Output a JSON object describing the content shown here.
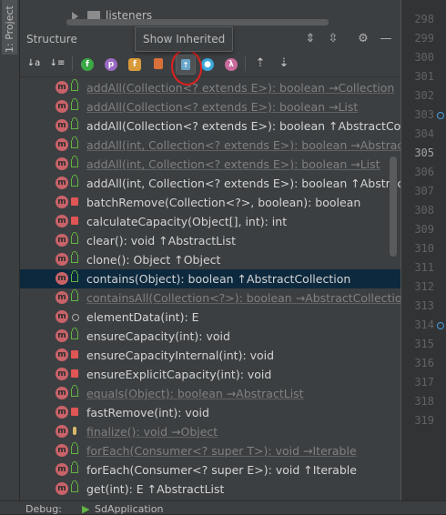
{
  "sidebar": {
    "tab_label": "1: Project"
  },
  "tree_top": {
    "node_label": "listeners"
  },
  "structure": {
    "title": "Structure",
    "tooltip": "Show Inherited",
    "title_icons": {
      "expand": "expand-all-icon",
      "collapse": "collapse-all-icon",
      "settings": "gear-icon",
      "hide": "minimize-icon"
    },
    "toolbar": [
      {
        "name": "sort-alpha-icon",
        "glyph": "↓a"
      },
      {
        "name": "sort-visibility-icon",
        "glyph": "↓≡"
      },
      {
        "name": "show-fields-icon",
        "glyph": "f",
        "color": "#3aa845"
      },
      {
        "name": "show-properties-icon",
        "glyph": "p",
        "color": "#9b6bc4"
      },
      {
        "name": "show-fields-f-icon",
        "glyph": "f",
        "color": "#d99a3a"
      },
      {
        "name": "show-non-public-icon",
        "glyph": "🔒"
      },
      {
        "name": "show-inherited-icon",
        "glyph": "↑",
        "selected": true
      },
      {
        "name": "show-anonymous-icon",
        "glyph": "●",
        "color": "#3ca6d9"
      },
      {
        "name": "show-lambdas-icon",
        "glyph": "λ",
        "color": "#c86a9b"
      },
      {
        "name": "autoscroll-to-source-icon",
        "glyph": "⇡"
      },
      {
        "name": "autoscroll-from-source-icon",
        "glyph": "⇣"
      }
    ]
  },
  "members": [
    {
      "access": "public",
      "text": "addAll(Collection<? extends E>): boolean →Collection",
      "inherited": true
    },
    {
      "access": "public",
      "text": "addAll(Collection<? extends E>): boolean →List",
      "inherited": true
    },
    {
      "access": "public",
      "text": "addAll(Collection<? extends E>): boolean ↑AbstractCollection",
      "inherited": false
    },
    {
      "access": "public",
      "text": "addAll(int, Collection<? extends E>): boolean →AbstractList",
      "inherited": true
    },
    {
      "access": "public",
      "text": "addAll(int, Collection<? extends E>): boolean →List",
      "inherited": true
    },
    {
      "access": "public",
      "text": "addAll(int, Collection<? extends E>): boolean ↑AbstractList",
      "inherited": false
    },
    {
      "access": "private",
      "text": "batchRemove(Collection<?>, boolean): boolean",
      "inherited": false
    },
    {
      "access": "private",
      "text": "calculateCapacity(Object[], int): int",
      "inherited": false
    },
    {
      "access": "public",
      "text": "clear(): void ↑AbstractList",
      "inherited": false
    },
    {
      "access": "public",
      "text": "clone(): Object ↑Object",
      "inherited": false
    },
    {
      "access": "public",
      "text": "contains(Object): boolean ↑AbstractCollection",
      "inherited": false,
      "selected": true
    },
    {
      "access": "public",
      "text": "containsAll(Collection<?>): boolean →AbstractCollection",
      "inherited": true
    },
    {
      "access": "package",
      "text": "elementData(int): E",
      "inherited": false
    },
    {
      "access": "public",
      "text": "ensureCapacity(int): void",
      "inherited": false
    },
    {
      "access": "private",
      "text": "ensureCapacityInternal(int): void",
      "inherited": false
    },
    {
      "access": "private",
      "text": "ensureExplicitCapacity(int): void",
      "inherited": false
    },
    {
      "access": "public",
      "text": "equals(Object): boolean →AbstractList",
      "inherited": true
    },
    {
      "access": "private",
      "text": "fastRemove(int): void",
      "inherited": false
    },
    {
      "access": "protected",
      "text": "finalize(): void →Object",
      "inherited": true
    },
    {
      "access": "public",
      "text": "forEach(Consumer<? super T>): void →Iterable",
      "inherited": true
    },
    {
      "access": "public",
      "text": "forEach(Consumer<? super E>): void ↑Iterable",
      "inherited": false
    },
    {
      "access": "public",
      "text": "get(int): E ↑AbstractList",
      "inherited": false
    }
  ],
  "line_numbers": [
    "298",
    "299",
    "300",
    "301",
    "302",
    "303",
    "304",
    "305",
    "306",
    "307",
    "308",
    "309",
    "310",
    "311",
    "312",
    "313",
    "314",
    "315",
    "316",
    "317",
    "318",
    "319"
  ],
  "current_line": "305",
  "gutter_markers": [
    "303",
    "314"
  ],
  "bottom_tabs": {
    "debug": "Debug:",
    "app": "SdApplication"
  }
}
